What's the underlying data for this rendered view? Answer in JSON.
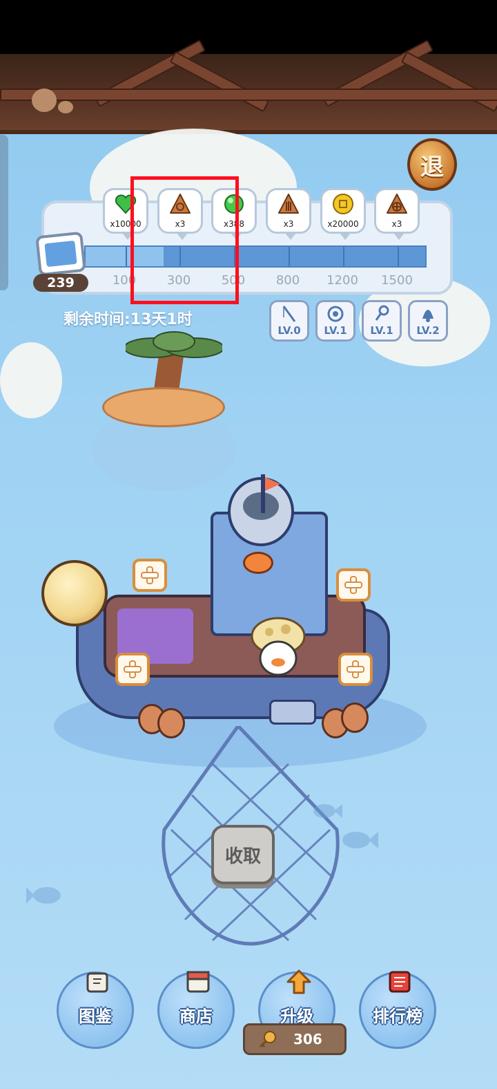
{
  "hud": {
    "exit_label": "退",
    "score": "239",
    "timer": "剩余时间:13天1时"
  },
  "rewards": [
    {
      "qty": "x10000",
      "icon": "green-heart-icon"
    },
    {
      "qty": "x3",
      "icon": "brown-triangle-token-icon"
    },
    {
      "qty": "x388",
      "icon": "green-orb-icon"
    },
    {
      "qty": "x3",
      "icon": "brown-triangle-token-icon"
    },
    {
      "qty": "x20000",
      "icon": "gold-coin-icon"
    },
    {
      "qty": "x3",
      "icon": "brown-triangle-token-icon"
    }
  ],
  "milestones": [
    "100",
    "300",
    "500",
    "800",
    "1200",
    "1500"
  ],
  "progress": {
    "value": 239,
    "max": 1500
  },
  "equipment": [
    {
      "label": "LV.0",
      "icon": "fishing-rod-icon"
    },
    {
      "label": "LV.1",
      "icon": "reel-icon"
    },
    {
      "label": "LV.1",
      "icon": "hook-icon"
    },
    {
      "label": "LV.2",
      "icon": "bell-icon"
    }
  ],
  "collect_label": "收取",
  "nav": [
    {
      "label": "图鉴",
      "icon": "book-icon"
    },
    {
      "label": "商店",
      "icon": "shop-icon"
    },
    {
      "label": "升级",
      "icon": "upgrade-arrow-icon"
    },
    {
      "label": "排行榜",
      "icon": "leaderboard-icon"
    }
  ],
  "currency": "306",
  "colors": {
    "highlight": "#ff0f1f",
    "sky": "#9fd2f3",
    "accent": "#5e97d6"
  }
}
